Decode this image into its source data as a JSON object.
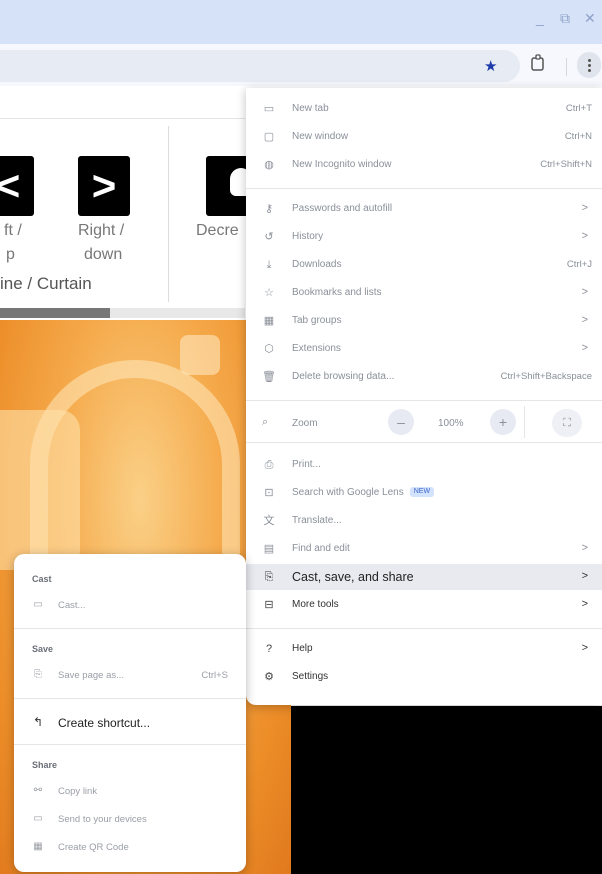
{
  "window": {
    "minimize": "_",
    "restore": "⧉",
    "close": "✕"
  },
  "toolbar": {
    "star": "★"
  },
  "page": {
    "left_tile_glyph": "<",
    "right_tile_glyph": ">",
    "label_left_line1": "ft /",
    "label_left_line2": "p",
    "label_right_line1": "Right /",
    "label_right_line2": "down",
    "label_decrease": "Decre",
    "label_group": "ine / Curtain"
  },
  "menu": {
    "items": [
      {
        "icon": "▭",
        "label": "New tab",
        "shortcut": "Ctrl+T"
      },
      {
        "icon": "▢",
        "label": "New window",
        "shortcut": "Ctrl+N"
      },
      {
        "icon": "◍",
        "label": "New Incognito window",
        "shortcut": "Ctrl+Shift+N"
      },
      {
        "icon": "⚷",
        "label": "Passwords and autofill",
        "arrow": ">"
      },
      {
        "icon": "↺",
        "label": "History",
        "arrow": ">"
      },
      {
        "icon": "⤓",
        "label": "Downloads",
        "shortcut": "Ctrl+J"
      },
      {
        "icon": "☆",
        "label": "Bookmarks and lists",
        "arrow": ">"
      },
      {
        "icon": "▦",
        "label": "Tab groups",
        "arrow": ">"
      },
      {
        "icon": "⬡",
        "label": "Extensions",
        "arrow": ">"
      },
      {
        "icon": "🗑",
        "label": "Delete browsing data...",
        "shortcut": "Ctrl+Shift+Backspace"
      }
    ],
    "zoom": {
      "icon": "⌕",
      "label": "Zoom",
      "minus": "–",
      "value": "100%",
      "plus": "+",
      "fullscreen": "⛶"
    },
    "items2": [
      {
        "icon": "⎙",
        "label": "Print..."
      },
      {
        "icon": "⊡",
        "label": "Search with Google Lens",
        "badge": "NEW"
      },
      {
        "icon": "文",
        "label": "Translate..."
      },
      {
        "icon": "▤",
        "label": "Find and edit",
        "arrow": ">"
      },
      {
        "icon": "⎘",
        "label": "Cast, save, and share",
        "arrow": ">"
      },
      {
        "icon": "⊟",
        "label": "More tools",
        "arrow": ">"
      }
    ],
    "items3": [
      {
        "icon": "?",
        "label": "Help",
        "arrow": ">"
      },
      {
        "icon": "⚙",
        "label": "Settings"
      }
    ]
  },
  "submenu": {
    "cast_header": "Cast",
    "cast": {
      "icon": "▭",
      "label": "Cast..."
    },
    "save_header": "Save",
    "save_page": {
      "icon": "⎘",
      "label": "Save page as...",
      "shortcut": "Ctrl+S"
    },
    "create_shortcut": {
      "icon": "↰",
      "label": "Create shortcut..."
    },
    "share_header": "Share",
    "copy_link": {
      "icon": "⚯",
      "label": "Copy link"
    },
    "send_devices": {
      "icon": "▭",
      "label": "Send to your devices"
    },
    "qr": {
      "icon": "▦",
      "label": "Create QR Code"
    }
  }
}
